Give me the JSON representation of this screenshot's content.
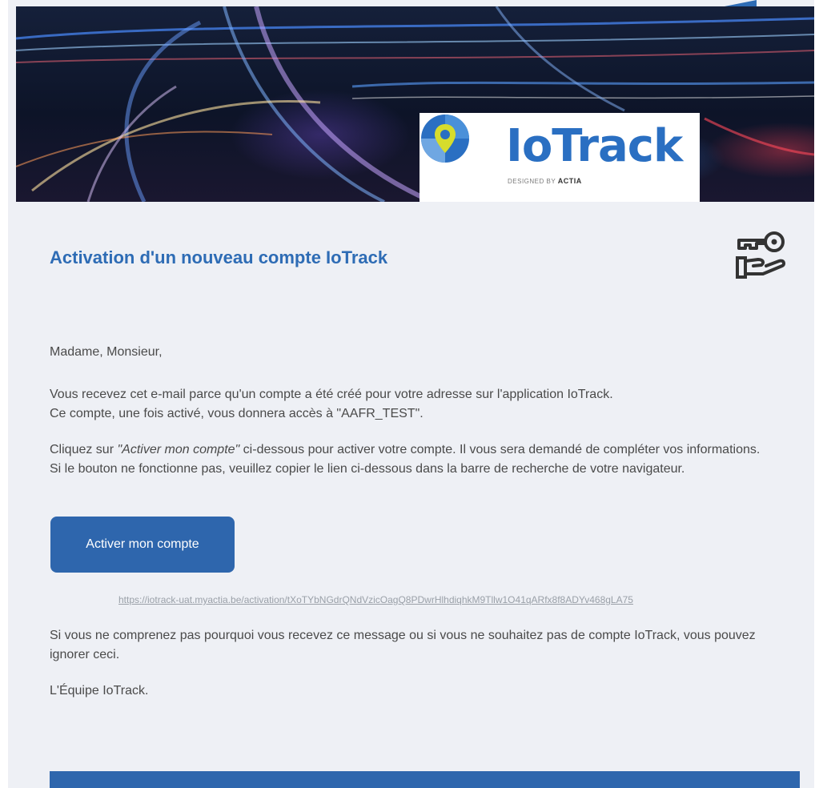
{
  "banner": {
    "brand_name": "IoTrack",
    "tagline_prefix": "DESIGNED BY",
    "tagline_brand": "ACTIA"
  },
  "header": {
    "title": "Activation d'un nouveau compte IoTrack",
    "icon": "key-in-hand-icon"
  },
  "body": {
    "greeting": "Madame, Monsieur,",
    "intro_line1": "Vous recevez cet e-mail parce qu'un compte a été créé pour votre adresse sur l'application IoTrack.",
    "intro_line2": "Ce compte, une fois activé, vous donnera accès à \"AAFR_TEST\".",
    "click_prefix": "Cliquez sur ",
    "click_emphasis": "\"Activer mon compte\"",
    "click_suffix": " ci-dessous pour activer votre compte. Il vous sera demandé de compléter vos informations.",
    "fallback": "Si le bouton ne fonctionne pas, veuillez copier le lien ci-dessous dans la barre de recherche de votre navigateur.",
    "button_label": "Activer mon compte",
    "activation_link": "https://iotrack-uat.myactia.be/activation/tXoTYbNGdrQNdVzicOagQ8PDwrHlhdiqhkM9Tllw1O41qARfx8f8ADYv468gLA75",
    "ignore_note": "Si vous ne comprenez pas pourquoi vous recevez ce message ou si vous ne souhaitez pas de compte IoTrack, vous pouvez ignorer ceci.",
    "signature": "L'Équipe IoTrack."
  },
  "colors": {
    "accent": "#2e6cb5",
    "button": "#2e66ad",
    "background": "#eef0f5",
    "text": "#4a4a4a",
    "link": "#9aa0a8"
  }
}
